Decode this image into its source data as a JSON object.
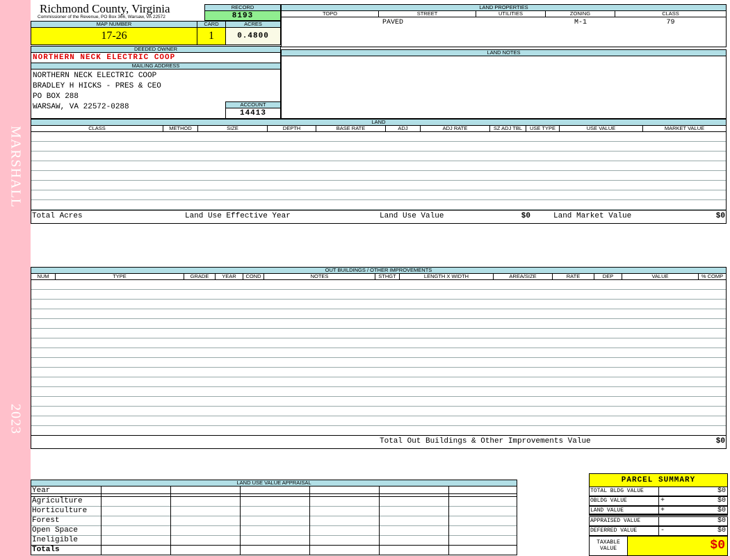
{
  "side": {
    "district": "MARSHALL",
    "year": "2023"
  },
  "header": {
    "county": "Richmond County, Virginia",
    "commissioner": "Commissioner of the Revenue, PO Box 366, Warsaw, VA 22572",
    "record_label": "RECORD",
    "record": "8193",
    "map_label": "MAP NUMBER",
    "map_number": "17-26",
    "card_label": "CARD",
    "card": "1",
    "acres_label": "ACRES",
    "acres": "0.4800",
    "owner_label": "DEEDED OWNER",
    "owner": "NORTHERN NECK ELECTRIC COOP",
    "mailing_label": "MAILING ADDRESS",
    "mailing": [
      "NORTHERN NECK ELECTRIC COOP",
      "BRADLEY H HICKS - PRES & CEO",
      "PO BOX 288",
      "WARSAW, VA 22572-0288"
    ],
    "account_label": "ACCOUNT",
    "account": "14413"
  },
  "land_properties": {
    "title": "LAND PROPERTIES",
    "columns": [
      "TOPO",
      "STREET",
      "UTILITIES",
      "ZONING",
      "CLASS"
    ],
    "values": [
      "",
      "PAVED",
      "",
      "M-1",
      "79"
    ]
  },
  "land_notes": {
    "title": "LAND NOTES"
  },
  "land": {
    "title": "LAND",
    "columns": [
      "CLASS",
      "METHOD",
      "SIZE",
      "DEPTH",
      "BASE RATE",
      "ADJ",
      "ADJ RATE",
      "SZ ADJ TBL",
      "USE TYPE",
      "USE VALUE",
      "MARKET VALUE"
    ],
    "total_acres_label": "Total Acres",
    "effective_year_label": "Land Use Effective Year",
    "use_value_label": "Land Use Value",
    "use_value": "$0",
    "market_value_label": "Land Market Value",
    "market_value": "$0"
  },
  "outbuildings": {
    "title": "OUT BUILDINGS / OTHER IMPROVEMENTS",
    "columns": [
      "NUM",
      "TYPE",
      "GRADE",
      "YEAR",
      "COND",
      "NOTES",
      "STHGT",
      "LENGTH X WIDTH",
      "AREA/SIZE",
      "RATE",
      "DEP",
      "VALUE",
      "% COMP"
    ],
    "total_label": "Total Out Buildings & Other Improvements Value",
    "total": "$0"
  },
  "land_use_appraisal": {
    "title": "LAND USE VALUE APPRAISAL",
    "rows": [
      "Year",
      "Agriculture",
      "Horticulture",
      "Forest",
      "Open Space",
      "Ineligible",
      "Totals"
    ]
  },
  "parcel_summary": {
    "title": "PARCEL SUMMARY",
    "rows": [
      {
        "label": "TOTAL BLDG VALUE",
        "op": "",
        "value": "$0"
      },
      {
        "label": "OBLDG VALUE",
        "op": "+",
        "value": "$0"
      },
      {
        "label": "LAND VALUE",
        "op": "+",
        "value": "$0"
      },
      {
        "label": "APPRAISED VALUE",
        "op": "",
        "value": "$0"
      },
      {
        "label": "DEFERRED VALUE",
        "op": "-",
        "value": "$0"
      }
    ],
    "taxable_label": "TAXABLE VALUE",
    "taxable": "$0"
  },
  "colors": {
    "side": "#ffc0cb",
    "header": "#b2dfe6",
    "highlight": "#ffff00",
    "record": "#90ee90",
    "owner": "#dd0000"
  }
}
